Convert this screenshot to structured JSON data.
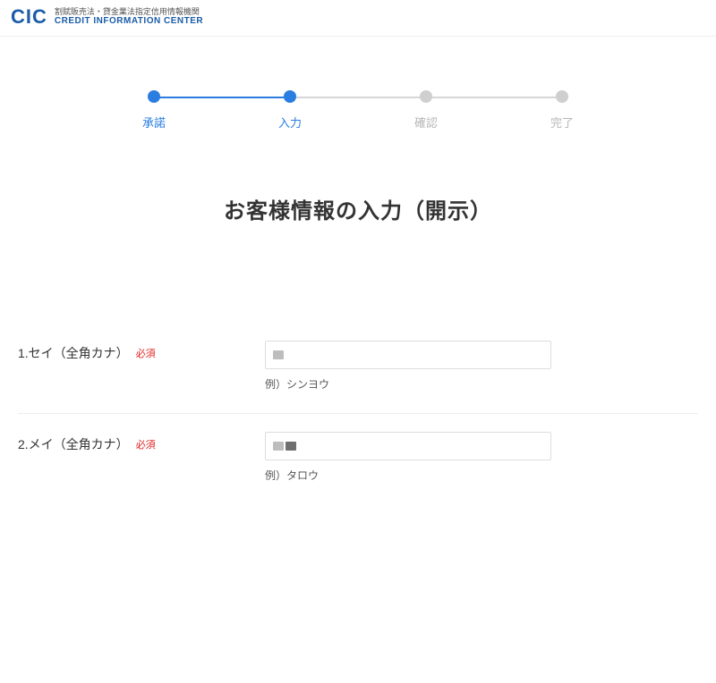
{
  "header": {
    "logo_text": "CIC",
    "logo_sub_jp": "割賦販売法・貸金業法指定信用情報機関",
    "logo_sub_en": "CREDIT INFORMATION CENTER"
  },
  "stepper": {
    "steps": [
      {
        "label": "承諾",
        "active": true
      },
      {
        "label": "入力",
        "active": true
      },
      {
        "label": "確認",
        "active": false
      },
      {
        "label": "完了",
        "active": false
      }
    ]
  },
  "page_title": "お客様情報の入力（開示）",
  "required_label": "必須",
  "fields": [
    {
      "label": "1.セイ（全角カナ）",
      "value": "",
      "hint": "例）シンヨウ"
    },
    {
      "label": "2.メイ（全角カナ）",
      "value": "",
      "hint": "例）タロウ"
    }
  ]
}
